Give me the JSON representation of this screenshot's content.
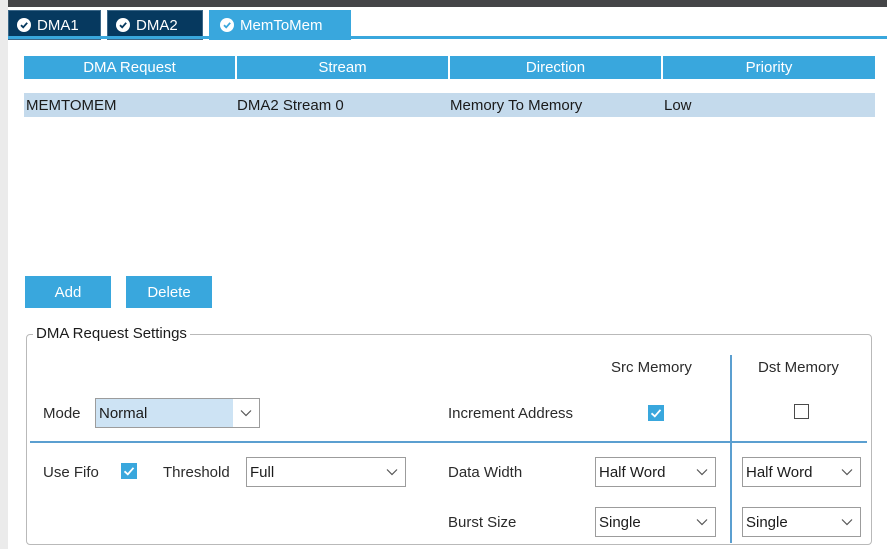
{
  "tabs": [
    {
      "label": "DMA1",
      "icon": "check-circle-icon"
    },
    {
      "label": "DMA2",
      "icon": "check-circle-icon"
    },
    {
      "label": "MemToMem",
      "icon": "check-circle-icon"
    }
  ],
  "table": {
    "headers": [
      "DMA Request",
      "Stream",
      "Direction",
      "Priority"
    ],
    "rows": [
      [
        "MEMTOMEM",
        "DMA2 Stream 0",
        "Memory To Memory",
        "Low"
      ]
    ]
  },
  "buttons": {
    "add": "Add",
    "delete": "Delete"
  },
  "settings": {
    "legend": "DMA Request Settings",
    "src_memory_header": "Src Memory",
    "dst_memory_header": "Dst Memory",
    "mode_label": "Mode",
    "mode_value": "Normal",
    "increment_address_label": "Increment Address",
    "src_increment_checked": true,
    "dst_increment_checked": false,
    "use_fifo_label": "Use Fifo",
    "use_fifo_checked": true,
    "threshold_label": "Threshold",
    "threshold_value": "Full",
    "data_width_label": "Data Width",
    "src_data_width": "Half Word",
    "dst_data_width": "Half Word",
    "burst_size_label": "Burst Size",
    "src_burst_size": "Single",
    "dst_burst_size": "Single"
  },
  "colors": {
    "accent": "#39a7dd",
    "tab_dark": "#06395f",
    "row_selected": "#c4daec",
    "separator": "#5b9fd0"
  }
}
